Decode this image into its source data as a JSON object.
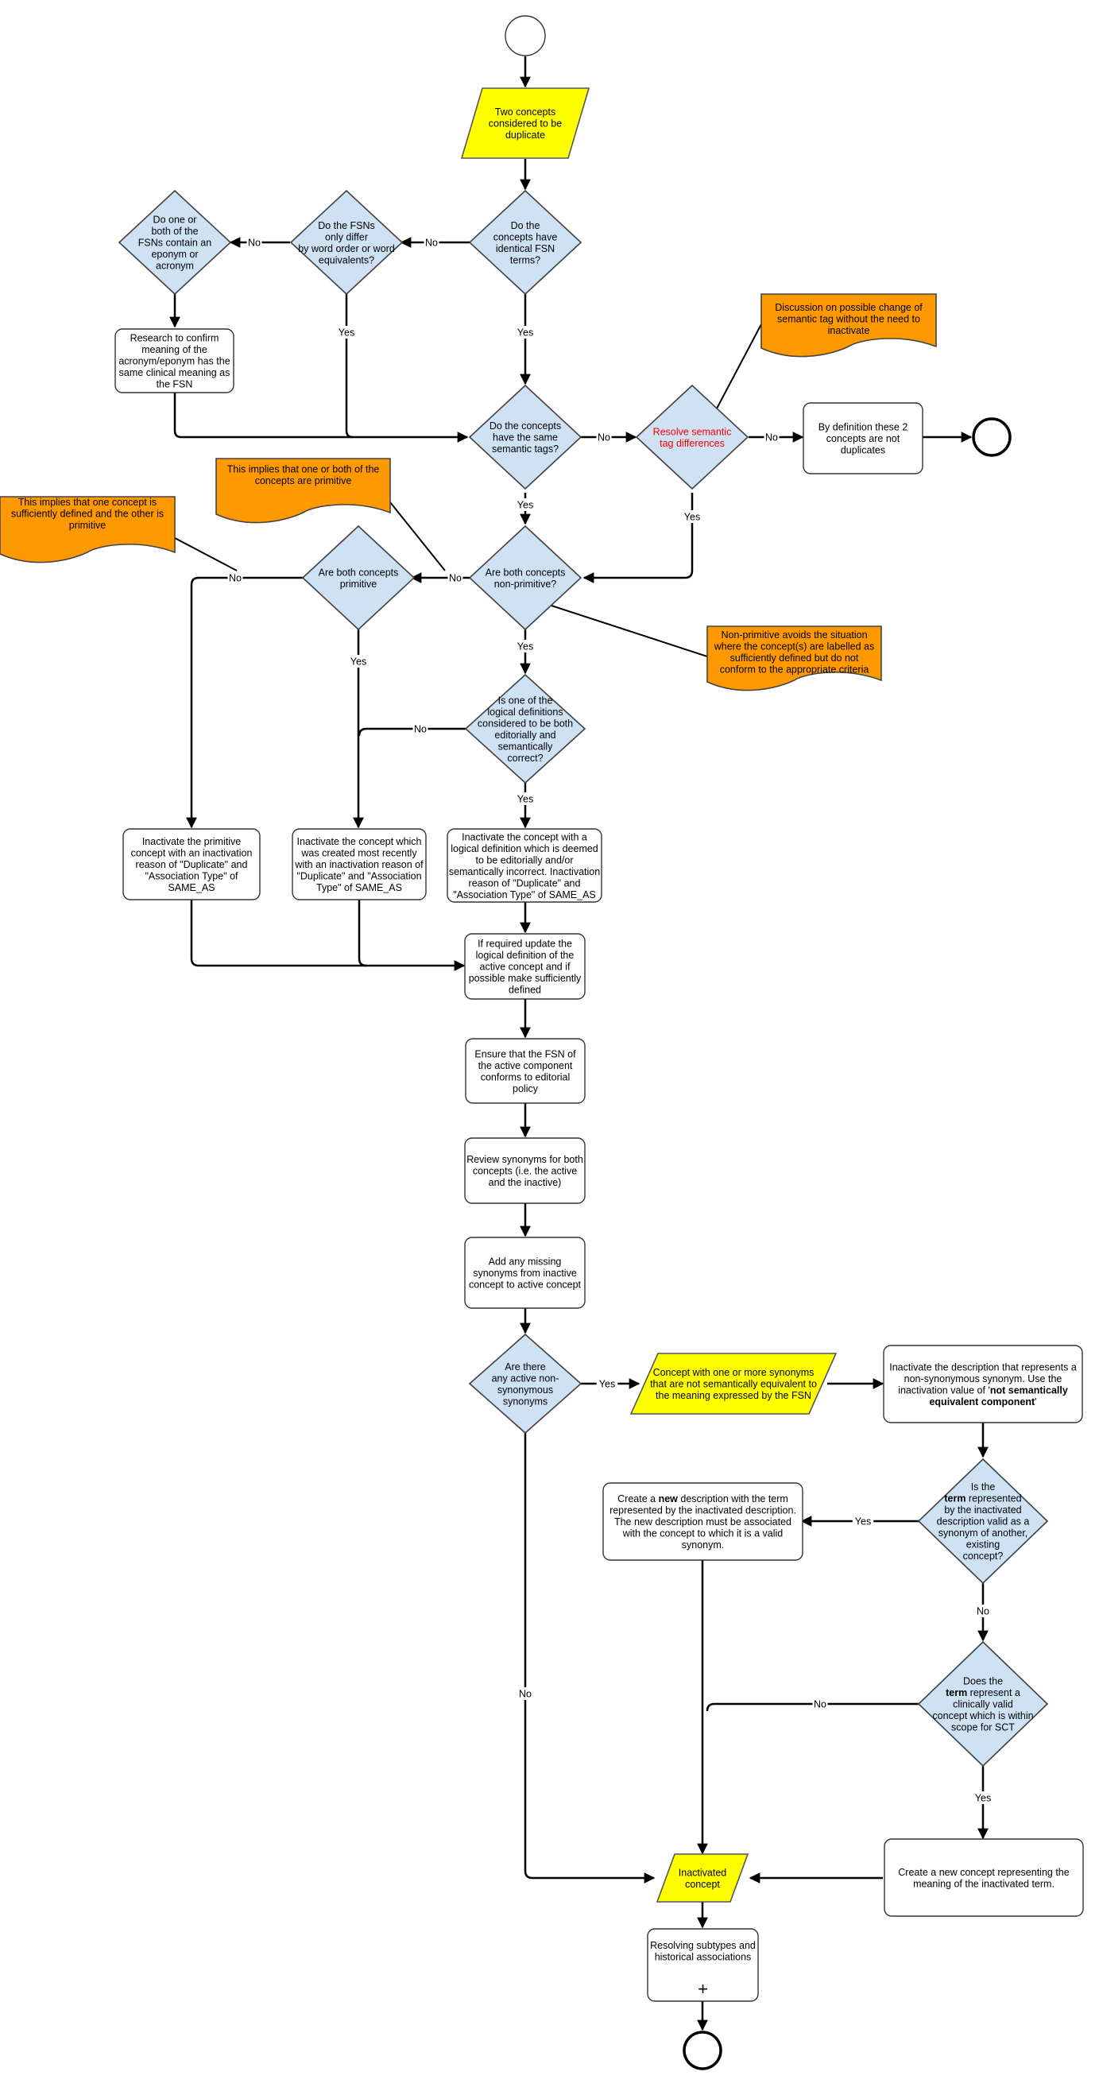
{
  "colors": {
    "decision": "#cfe2f3",
    "data": "#ffff00",
    "note": "#ff9900",
    "warning_text": "#ff0000"
  },
  "nodes": {
    "start": {
      "type": "start-event"
    },
    "two_concepts": {
      "type": "data",
      "lines": [
        "Two concepts",
        "considered to be",
        "duplicate"
      ]
    },
    "identical_fsn": {
      "type": "decision",
      "lines": [
        "Do the",
        "concepts have",
        "identical FSN",
        "terms?"
      ]
    },
    "word_order": {
      "type": "decision",
      "lines": [
        "Do the FSNs",
        "only differ",
        "by word order or word",
        "equivalents?"
      ]
    },
    "eponym": {
      "type": "decision",
      "lines": [
        "Do one or",
        "both of the",
        "FSNs contain an",
        "eponym or",
        "acronym"
      ]
    },
    "research": {
      "type": "task",
      "lines": [
        "Research to confirm",
        "meaning of the",
        "acronym/eponym has the",
        "same clinical meaning as",
        "the FSN"
      ]
    },
    "same_tags": {
      "type": "decision",
      "lines": [
        "Do the concepts",
        "have the same",
        "semantic tags?"
      ]
    },
    "resolve_tags": {
      "type": "decision",
      "lines": [
        "Resolve semantic",
        "tag differences"
      ]
    },
    "not_duplicates": {
      "type": "task",
      "lines": [
        "By definition these 2",
        "concepts are not",
        "duplicates"
      ]
    },
    "end_top": {
      "type": "end-event"
    },
    "note_semantic_tag": {
      "type": "note",
      "lines": [
        "Discussion on possible change of",
        "semantic tag without the need to",
        "inactivate"
      ]
    },
    "note_one_or_both": {
      "type": "note",
      "lines": [
        "This implies that one or both of the",
        "concepts are primitive"
      ]
    },
    "note_one_sufficient": {
      "type": "note",
      "lines": [
        "This implies that one concept is",
        "sufficiently defined and the other is",
        "primitive"
      ]
    },
    "note_non_primitive": {
      "type": "note",
      "lines": [
        "Non-primitive avoids the situation",
        "where the concept(s) are labelled as",
        "sufficiently defined but do not",
        "conform to the appropriate criteria"
      ]
    },
    "both_non_primitive": {
      "type": "decision",
      "lines": [
        "Are both concepts",
        "non-primitive?"
      ]
    },
    "both_primitive": {
      "type": "decision",
      "lines": [
        "Are both concepts",
        "primitive"
      ]
    },
    "logical_def": {
      "type": "decision",
      "lines": [
        "Is one of the",
        "logical definitions",
        "considered to be both",
        "editorially and",
        "semantically",
        "correct?"
      ]
    },
    "inactivate_primitive": {
      "type": "task",
      "lines": [
        "Inactivate the primitive",
        "concept with an inactivation",
        "reason of \"Duplicate\" and",
        "\"Association Type\" of",
        "SAME_AS"
      ]
    },
    "inactivate_recent": {
      "type": "task",
      "lines": [
        "Inactivate the concept which",
        "was created most recently",
        "with an inactivation reason of",
        "\"Duplicate\" and \"Association",
        "Type\" of SAME_AS"
      ]
    },
    "inactivate_incorrect": {
      "type": "task",
      "lines": [
        "Inactivate the concept with a",
        "logical definition which is deemed",
        "to be editorially and/or",
        "semantically incorrect. Inactivation",
        "reason of \"Duplicate\" and",
        "\"Association Type\" of SAME_AS"
      ]
    },
    "update_logical": {
      "type": "task",
      "lines": [
        "If required update the",
        "logical definition of the",
        "active concept and if",
        "possible make sufficiently",
        "defined"
      ]
    },
    "ensure_fsn": {
      "type": "task",
      "lines": [
        "Ensure that the FSN of",
        "the active component",
        "conforms to editorial",
        "policy"
      ]
    },
    "review_synonyms": {
      "type": "task",
      "lines": [
        "Review synonyms for both",
        "concepts (i.e. the active",
        "and the inactive)"
      ]
    },
    "add_synonyms": {
      "type": "task",
      "lines": [
        "Add any missing",
        "synonyms from inactive",
        "concept to active concept"
      ]
    },
    "non_synonymous": {
      "type": "decision",
      "lines": [
        "Are there",
        "any active non-",
        "synonymous",
        "synonyms"
      ]
    },
    "concept_with_synonyms": {
      "type": "data",
      "lines": [
        "Concept with one or more synonyms",
        "that are not semantically equivalent to",
        "the meaning expressed by the FSN"
      ]
    },
    "inactivate_description": {
      "type": "task",
      "lines": [
        [
          {
            "t": "Inactivate the description that represents a"
          }
        ],
        [
          {
            "t": "non-synonymous synonym. Use the"
          }
        ],
        [
          {
            "t": "inactivation value of '"
          },
          {
            "t": "not semantically",
            "b": true
          }
        ],
        [
          {
            "t": "equivalent component",
            "b": true
          },
          {
            "t": "'"
          }
        ]
      ]
    },
    "term_valid_synonym": {
      "type": "decision",
      "lines": [
        [
          {
            "t": "Is the"
          }
        ],
        [
          {
            "t": "term",
            "b": true
          },
          {
            "t": " represented"
          }
        ],
        [
          {
            "t": "by the inactivated"
          }
        ],
        [
          {
            "t": "description valid as a"
          }
        ],
        [
          {
            "t": "synonym of another,"
          }
        ],
        [
          {
            "t": "existing"
          }
        ],
        [
          {
            "t": "concept?"
          }
        ]
      ]
    },
    "create_description": {
      "type": "task",
      "lines": [
        [
          {
            "t": "Create a "
          },
          {
            "t": "new",
            "b": true
          },
          {
            "t": " description with the term"
          }
        ],
        [
          {
            "t": "represented by the inactivated description."
          }
        ],
        [
          {
            "t": "The new description must be associated"
          }
        ],
        [
          {
            "t": "with the concept to which it is a valid"
          }
        ],
        [
          {
            "t": "synonym."
          }
        ]
      ]
    },
    "clinically_valid": {
      "type": "decision",
      "lines": [
        [
          {
            "t": "Does the"
          }
        ],
        [
          {
            "t": "term",
            "b": true
          },
          {
            "t": " represent a"
          }
        ],
        [
          {
            "t": "clinically valid"
          }
        ],
        [
          {
            "t": "concept which is within"
          }
        ],
        [
          {
            "t": "scope for SCT"
          }
        ]
      ]
    },
    "create_concept": {
      "type": "task",
      "lines": [
        "Create a new concept representing the",
        "meaning of the inactivated term."
      ]
    },
    "inactivated_concept": {
      "type": "data",
      "lines": [
        "Inactivated",
        "concept"
      ]
    },
    "resolving_subtypes": {
      "type": "subprocess",
      "lines": [
        "Resolving subtypes and",
        "historical associations"
      ],
      "marker": "+"
    },
    "end_bottom": {
      "type": "end-event"
    }
  },
  "edge_labels": {
    "yes": "Yes",
    "no": "No"
  }
}
